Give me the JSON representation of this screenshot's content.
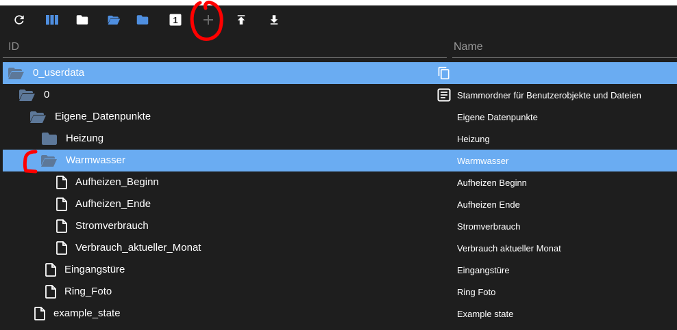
{
  "toolbar": {
    "buttons": [
      {
        "icon": "refresh-icon"
      },
      {
        "icon": "columns-icon"
      },
      {
        "icon": "folder-icon"
      },
      {
        "icon": "folder-open-icon"
      },
      {
        "icon": "folder-icon"
      },
      {
        "icon": "badge-icon",
        "label": "1"
      },
      {
        "icon": "plus-icon"
      },
      {
        "icon": "upload-icon"
      },
      {
        "icon": "download-icon"
      }
    ]
  },
  "header": {
    "id_label": "ID",
    "name_label": "Name"
  },
  "tree": [
    {
      "id": "0_userdata",
      "name": "",
      "type": "folder-open",
      "selected": true
    },
    {
      "id": "0",
      "name": "Stammordner für Benutzerobjekte und Dateien",
      "type": "folder-open",
      "selected": false
    },
    {
      "id": "Eigene_Datenpunkte",
      "name": "Eigene Datenpunkte",
      "type": "folder-open",
      "selected": false
    },
    {
      "id": "Heizung",
      "name": "Heizung",
      "type": "folder",
      "selected": false
    },
    {
      "id": "Warmwasser",
      "name": "Warmwasser",
      "type": "folder-open",
      "selected": true
    },
    {
      "id": "Aufheizen_Beginn",
      "name": "Aufheizen Beginn",
      "type": "file",
      "selected": false
    },
    {
      "id": "Aufheizen_Ende",
      "name": "Aufheizen Ende",
      "type": "file",
      "selected": false
    },
    {
      "id": "Stromverbrauch",
      "name": "Stromverbrauch",
      "type": "file",
      "selected": false
    },
    {
      "id": "Verbrauch_aktueller_Monat",
      "name": "Verbrauch aktueller Monat",
      "type": "file",
      "selected": false
    },
    {
      "id": "Eingangstüre",
      "name": "Eingangstüre",
      "type": "file",
      "selected": false
    },
    {
      "id": "Ring_Foto",
      "name": "Ring Foto",
      "type": "file",
      "selected": false
    },
    {
      "id": "example_state",
      "name": "Example state",
      "type": "file",
      "selected": false
    }
  ],
  "colors": {
    "background": "#1e1e1e",
    "selection": "#6aacf2",
    "folder_blue": "#4f8fe0",
    "folder_dark": "#5d7899",
    "annotation_red": "#ff0000"
  }
}
